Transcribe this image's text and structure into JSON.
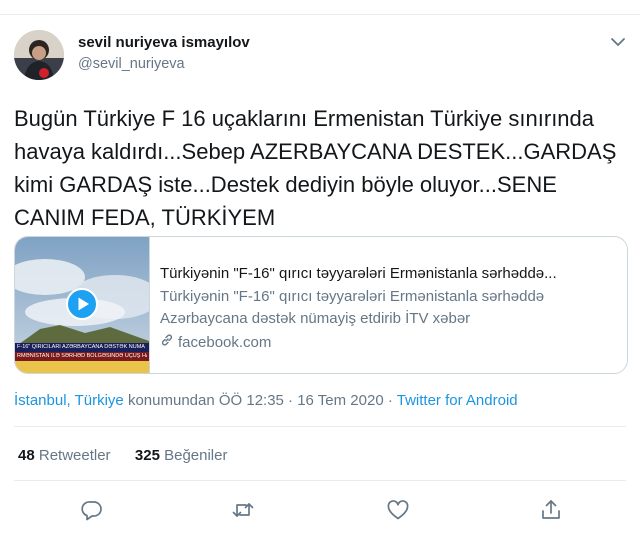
{
  "tweet": {
    "author_name": "sevil nuriyeva ismayılov",
    "author_handle": "@sevil_nuriyeva",
    "text": "Bugün Türkiye F 16 uçaklarını Ermenistan Türkiye sınırında havaya kaldırdı...Sebep AZERBAYCANA DESTEK...GARDAŞ kimi GARDAŞ iste...Destek dediyin böyle oluyor...SENE CANIM FEDA, TÜRKİYEM",
    "card": {
      "title": "Türkiyənin \"F-16\" qırıcı təyyarələri Ermənistanla sərhəddə...",
      "description_line1": "Türkiyənin \"F-16\" qırıcı təyyarələri Ermənistanla sərhəddə",
      "description_line2": "Azərbaycana dəstək nümayiş etdirib İTV xəbər",
      "domain": "facebook.com",
      "media_caption1": "F-16\" QIRICILARI AZƏRBAYCANA DƏSTƏK NÜMA",
      "media_caption2": "RMƏNİSTAN İLƏ SƏRHƏD BÖLGƏSİNDƏ UÇUŞ HAYATA KEÇİRİLDİ"
    },
    "location": "İstanbul, Türkiye",
    "location_suffix": " konumundan ÖÖ 12:35 · 16 Tem 2020 · ",
    "source": "Twitter for Android",
    "retweets_count": "48",
    "retweets_label": " Retweetler",
    "likes_count": "325",
    "likes_label": " Beğeniler"
  },
  "icons": [
    "chevron-down-icon",
    "play-icon",
    "link-icon",
    "reply-icon",
    "retweet-icon",
    "like-icon",
    "share-icon"
  ],
  "colors": {
    "accent": "#1da1f2",
    "link": "#1b95e0",
    "secondary_text": "#657786",
    "border": "#ccd6dd"
  }
}
